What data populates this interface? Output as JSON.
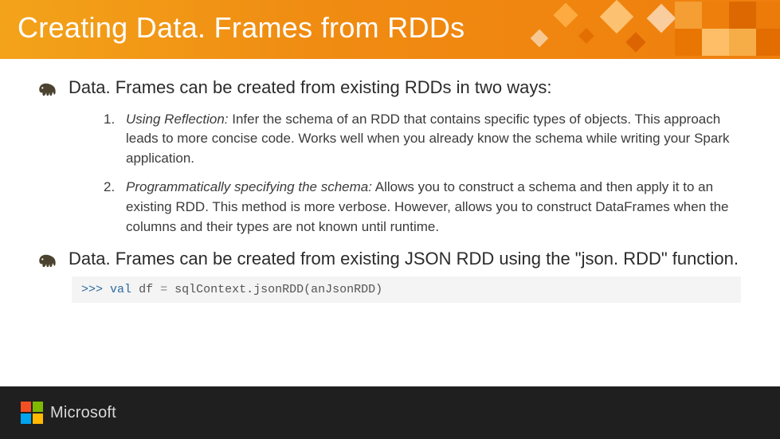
{
  "title": "Creating Data. Frames from RDDs",
  "bullets": [
    "Data. Frames can be created from existing RDDs in two ways:",
    "Data. Frames can be created from existing JSON RDD using the \"json. RDD\" function."
  ],
  "items": [
    {
      "emph": "Using Reflection:",
      "rest": " Infer the schema of an RDD that contains specific types of objects. This approach leads to more concise code. Works well when you already know the schema while writing your Spark application."
    },
    {
      "emph": "Programmatically specifying the schema:",
      "rest": " Allows you to construct a schema and then apply it to an existing RDD. This method is more verbose. However, allows you to construct DataFrames when the columns and their types are not known until runtime."
    }
  ],
  "code": {
    "prompt": ">>>",
    "kw": "val",
    "lhs": "df",
    "op": "=",
    "rhs": "sqlContext.jsonRDD(anJsonRDD)"
  },
  "footer": {
    "brand": "Microsoft"
  },
  "chart_data": {
    "type": "table",
    "note": "presentation slide, no chart data"
  }
}
